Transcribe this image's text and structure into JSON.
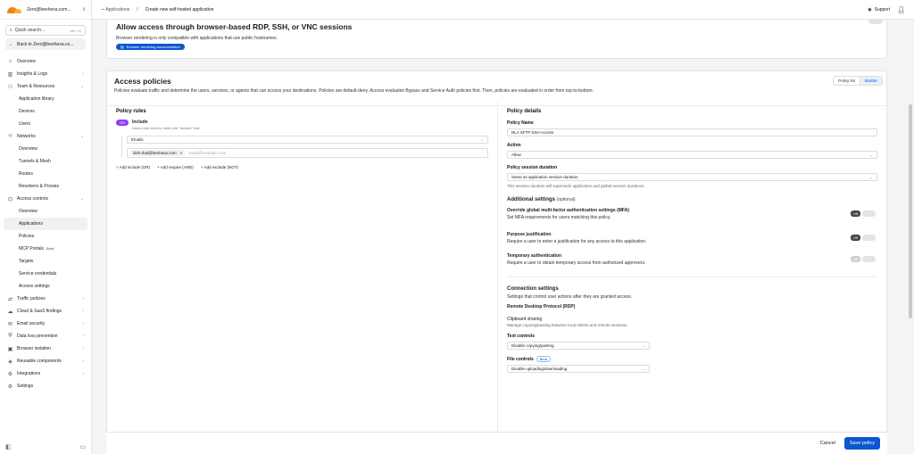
{
  "sidebar": {
    "account": "Zero@beehexa.com...",
    "search_placeholder": "Quick search...",
    "search_shortcut": "ctrl + K",
    "back_label": "Back to Zero@beehexa.co...",
    "items": [
      {
        "label": "Overview"
      },
      {
        "label": "Insights & Logs"
      },
      {
        "label": "Team & Resources"
      },
      {
        "label": "Application library"
      },
      {
        "label": "Devices"
      },
      {
        "label": "Users"
      },
      {
        "label": "Networks"
      },
      {
        "label": "Overview"
      },
      {
        "label": "Tunnels & Mesh"
      },
      {
        "label": "Routes"
      },
      {
        "label": "Resolvers & Proxies"
      },
      {
        "label": "Access controls"
      },
      {
        "label": "Overview"
      },
      {
        "label": "Applications"
      },
      {
        "label": "Policies"
      },
      {
        "label": "MCP Portals",
        "badge": "Beta"
      },
      {
        "label": "Targets"
      },
      {
        "label": "Service credentials"
      },
      {
        "label": "Access settings"
      },
      {
        "label": "Traffic policies"
      },
      {
        "label": "Cloud & SaaS findings"
      },
      {
        "label": "Email security"
      },
      {
        "label": "Data loss prevention"
      },
      {
        "label": "Browser isolation"
      },
      {
        "label": "Reusable components"
      },
      {
        "label": "Integrations"
      },
      {
        "label": "Settings"
      }
    ]
  },
  "topbar": {
    "crumb_parent": "Applications",
    "crumb_current": "Create new self-hosted application",
    "support": "Support"
  },
  "browser_card": {
    "title": "Allow access through browser-based RDP, SSH, or VNC sessions",
    "desc": "Browser rendering is only compatible with applications that use public hostnames.",
    "doc_link": "Browser rendering documentation"
  },
  "policies": {
    "title": "Access policies",
    "desc": "Policies evaluate traffic and determine the users, services, or agents that can access your destinations. Policies are default-deny. Access evaluates Bypass and Service Auth policies first. Then, policies are evaluated in order from top-to-bottom.",
    "tab_list": "Policy list",
    "tab_builder": "Builder",
    "rules": {
      "title": "Policy rules",
      "or_label": "OR",
      "include_title": "Include",
      "include_hint": "Users only need to meet one \"Include\" rule",
      "selector": "Emails",
      "chip": "dinh.thai@beehexa.com",
      "chip_x": "×",
      "email_placeholder": "email@example.com",
      "add_include": "+ Add include (OR)",
      "add_require": "+ Add require (AND)",
      "add_exclude": "+ Add exclude (NOT)"
    },
    "details": {
      "title": "Policy details",
      "name_label": "Policy Name",
      "name_value": "NLA SFTP SSH Access",
      "action_label": "Action",
      "action_value": "Allow",
      "duration_label": "Policy session duration",
      "duration_value": "Same as application session duration",
      "duration_hint": "This session duration will supersede application and global session durations.",
      "additional": "Additional settings",
      "optional": "(optional)",
      "mfa_title": "Override global multi-factor authentication settings (MFA)",
      "mfa_desc": "Set MFA requirements for users matching this policy.",
      "purpose_title": "Purpose justification",
      "purpose_desc": "Require a user to enter a justification for any access to this application.",
      "temp_title": "Temporary authentication",
      "temp_desc": "Require a user to obtain temporary access from authorized approvers.",
      "off": "Off",
      "conn_title": "Connection settings",
      "conn_desc": "Settings that control user actions after they are granted access.",
      "rdp": "Remote Desktop Protocol (RDP)",
      "clip_title": "Clipboard sharing",
      "clip_desc": "Manage copying/pasting between local clients and remote sessions.",
      "text_controls": "Text controls",
      "text_value": "Disable copying/pasting",
      "file_controls": "File controls",
      "file_beta": "Beta",
      "file_value": "Disable uploading/downloading"
    }
  },
  "footer": {
    "cancel": "Cancel",
    "save": "Save policy"
  }
}
